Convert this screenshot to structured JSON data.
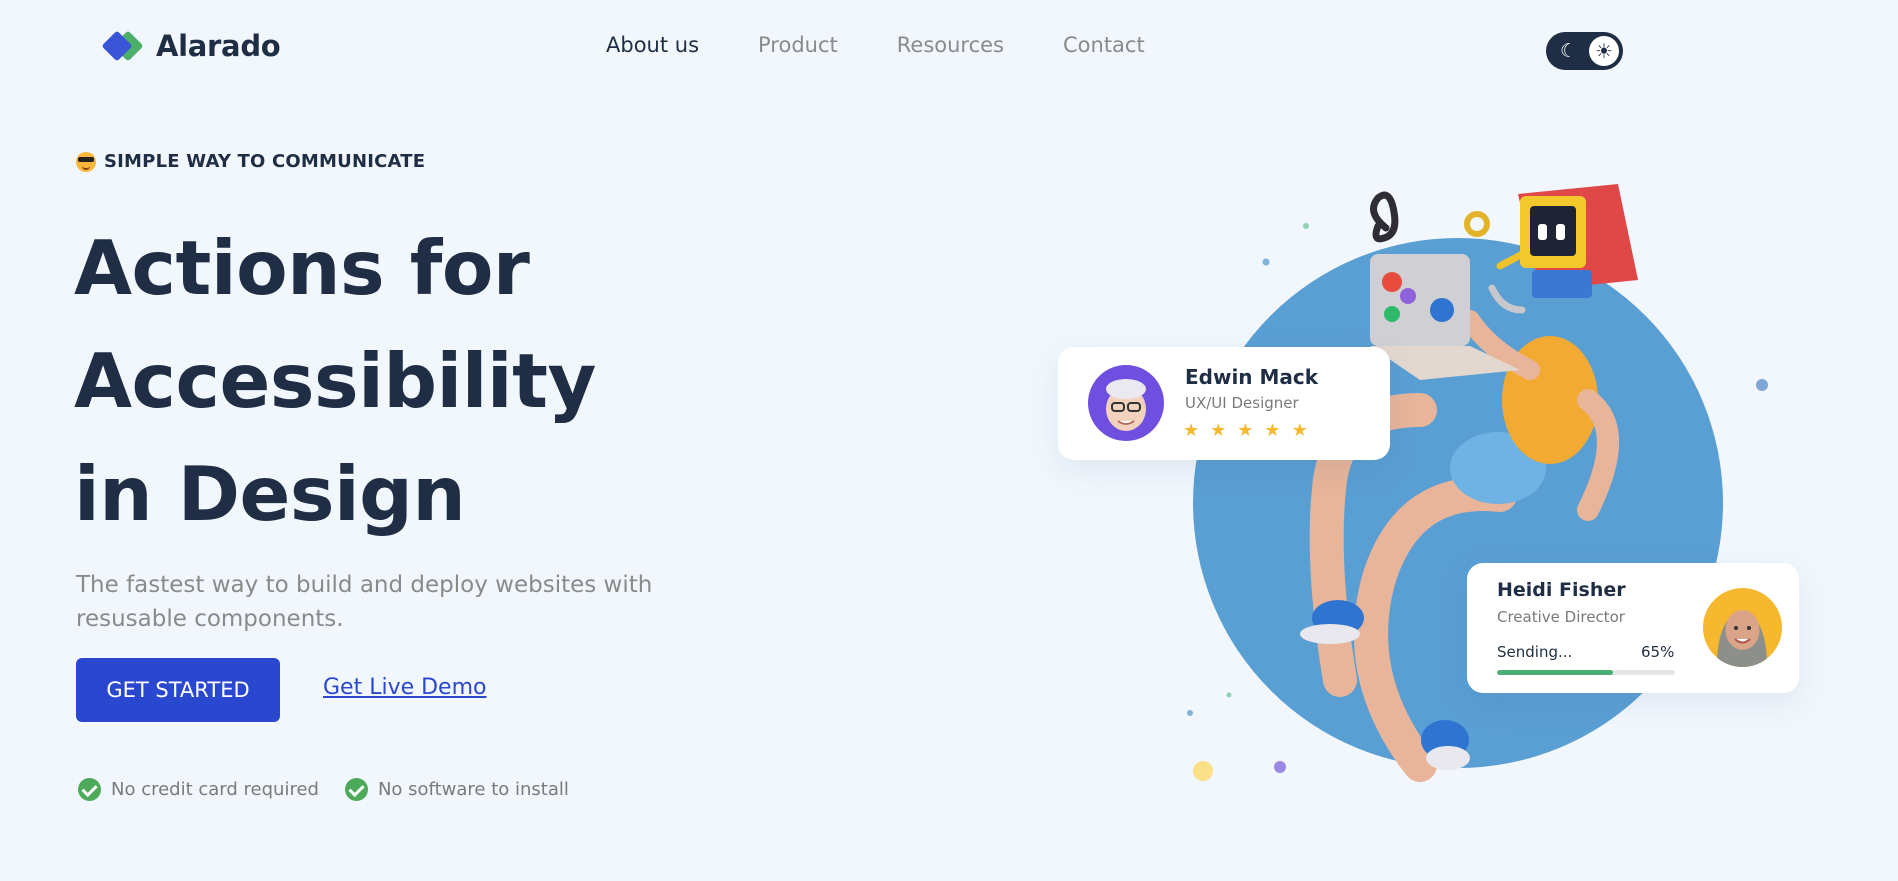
{
  "brand": {
    "name": "Alarado",
    "primary_color": "#2a48cf",
    "accent_green": "#4caf6a",
    "dark": "#1f2e44"
  },
  "nav": {
    "items": [
      {
        "label": "About us",
        "active": true
      },
      {
        "label": "Product",
        "active": false
      },
      {
        "label": "Resources",
        "active": false
      },
      {
        "label": "Contact",
        "active": false
      }
    ],
    "theme_toggle": {
      "moon_icon": "moon-icon",
      "sun_icon": "sun-icon",
      "mode": "light"
    }
  },
  "hero": {
    "eyebrow": "SIMPLE WAY TO COMMUNICATE",
    "headline_lines": [
      "Actions for",
      "Accessibility",
      "in Design"
    ],
    "subtitle": "The fastest way to build and deploy websites with resusable components.",
    "cta_primary": "GET STARTED",
    "cta_secondary": "Get Live Demo",
    "checks": [
      "No credit card required",
      "No software to install"
    ]
  },
  "cards": {
    "edwin": {
      "name": "Edwin Mack",
      "role": "UX/UI Designer",
      "rating": 5
    },
    "heidi": {
      "name": "Heidi Fisher",
      "role": "Creative Director",
      "status": "Sending...",
      "progress_label": "65%",
      "progress": 0.65
    }
  }
}
